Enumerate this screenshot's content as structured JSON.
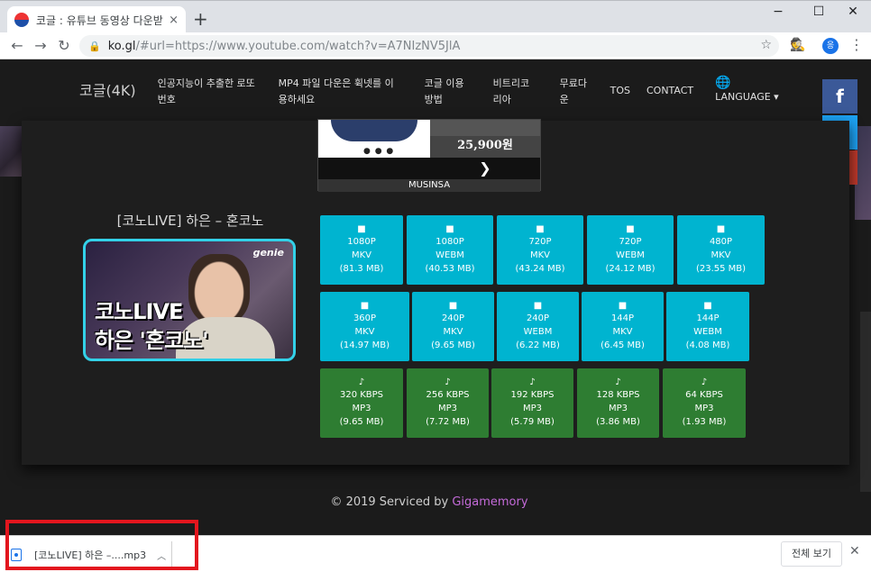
{
  "browser": {
    "tab_title": "코글 : 유튜브 동영상 다운받는법",
    "tab_close": "×",
    "new_tab": "+",
    "url_host": "ko.gl",
    "url_rest": "/#url=https://www.youtube.com/watch?v=A7NIzNV5JlA",
    "profile_initial": "응",
    "window_controls": {
      "minimize": "−",
      "maximize": "☐",
      "close": "✕"
    }
  },
  "navbar": {
    "brand": "코글(4K)",
    "links": [
      "인공지능이 추출한 로또 번호",
      "MP4 파일 다운은 휙넷를 이용하세요",
      "코글 이용 방법",
      "비트리코리아",
      "무료다운",
      "TOS",
      "CONTACT"
    ],
    "language": "LANGUAGE ▾"
  },
  "share": {
    "facebook": "f",
    "twitter": "t",
    "more": "+"
  },
  "ad": {
    "price": "25,900원",
    "brand": "MUSINSA",
    "next": "❯"
  },
  "video": {
    "title": "[코노LIVE] 하은 – 혼코노",
    "thumb_logo": "genie",
    "thumb_caption1": "코노LIVE",
    "thumb_caption2": "하은 '혼코노'"
  },
  "video_formats_row1": [
    {
      "res": "1080P",
      "fmt": "MKV",
      "size": "(81.3 MB)"
    },
    {
      "res": "1080P",
      "fmt": "WEBM",
      "size": "(40.53 MB)"
    },
    {
      "res": "720P",
      "fmt": "MKV",
      "size": "(43.24 MB)"
    },
    {
      "res": "720P",
      "fmt": "WEBM",
      "size": "(24.12 MB)"
    },
    {
      "res": "480P",
      "fmt": "MKV",
      "size": "(23.55 MB)"
    }
  ],
  "video_formats_row2": [
    {
      "res": "360P",
      "fmt": "MKV",
      "size": "(14.97 MB)"
    },
    {
      "res": "240P",
      "fmt": "MKV",
      "size": "(9.65 MB)"
    },
    {
      "res": "240P",
      "fmt": "WEBM",
      "size": "(6.22 MB)"
    },
    {
      "res": "144P",
      "fmt": "MKV",
      "size": "(6.45 MB)"
    },
    {
      "res": "144P",
      "fmt": "WEBM",
      "size": "(4.08 MB)"
    }
  ],
  "audio_formats": [
    {
      "res": "320 KBPS",
      "fmt": "MP3",
      "size": "(9.65 MB)"
    },
    {
      "res": "256 KBPS",
      "fmt": "MP3",
      "size": "(7.72 MB)"
    },
    {
      "res": "192 KBPS",
      "fmt": "MP3",
      "size": "(5.79 MB)"
    },
    {
      "res": "128 KBPS",
      "fmt": "MP3",
      "size": "(3.86 MB)"
    },
    {
      "res": "64 KBPS",
      "fmt": "MP3",
      "size": "(1.93 MB)"
    }
  ],
  "footer": {
    "prefix": "© 2019 Serviced by ",
    "link": "Gigamemory"
  },
  "download_shelf": {
    "file_name": "[코노LIVE] 하은 –....mp3",
    "show_all": "전체 보기",
    "close": "✕"
  },
  "colors": {
    "video_button": "#00b4d0",
    "audio_button": "#2e7d32",
    "highlight_box": "#e3161e",
    "footer_link": "#c36ad8"
  }
}
